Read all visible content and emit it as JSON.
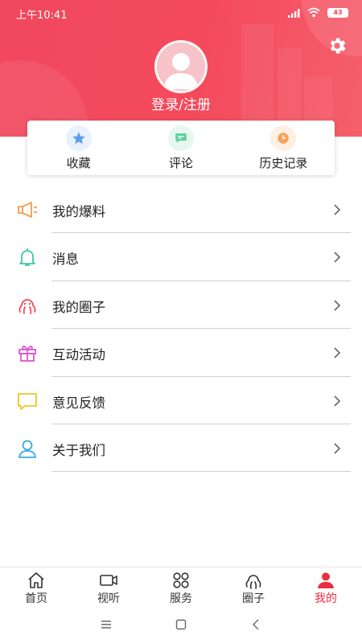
{
  "status_bar": {
    "time": "上午10:41",
    "battery": "43"
  },
  "profile": {
    "login_label": "登录/注册"
  },
  "quick_actions": [
    {
      "label": "收藏",
      "icon": "star-icon",
      "color": "#5a9df0"
    },
    {
      "label": "评论",
      "icon": "comment-icon",
      "color": "#5fcf9b"
    },
    {
      "label": "历史记录",
      "icon": "clock-icon",
      "color": "#f2a35a"
    }
  ],
  "menu": [
    {
      "label": "我的爆料",
      "icon": "megaphone-icon",
      "color": "#f39a4a"
    },
    {
      "label": "消息",
      "icon": "bell-icon",
      "color": "#3fc7a4"
    },
    {
      "label": "我的圈子",
      "icon": "octopus-icon",
      "color": "#ef4d5b"
    },
    {
      "label": "互动活动",
      "icon": "gift-icon",
      "color": "#de57d0"
    },
    {
      "label": "意见反馈",
      "icon": "feedback-icon",
      "color": "#f5c324"
    },
    {
      "label": "关于我们",
      "icon": "person-icon",
      "color": "#3aa6ec"
    }
  ],
  "tabs": [
    {
      "label": "首页",
      "icon": "home-icon"
    },
    {
      "label": "视听",
      "icon": "video-icon"
    },
    {
      "label": "服务",
      "icon": "grid-icon"
    },
    {
      "label": "圈子",
      "icon": "octopus-icon"
    },
    {
      "label": "我的",
      "icon": "user-icon",
      "active": true
    }
  ],
  "colors": {
    "brand": "#f2485f",
    "active_tab": "#ec2d3f"
  }
}
